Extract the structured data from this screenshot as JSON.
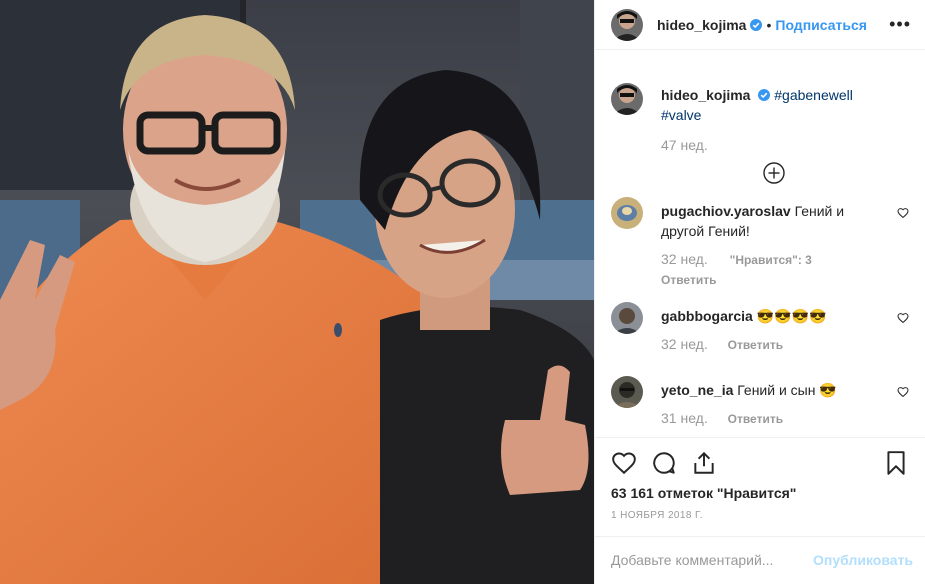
{
  "post": {
    "author": "hideo_kojima",
    "follow_label": "Подписаться",
    "dot": "•",
    "more_label": "•••"
  },
  "caption": {
    "author": "hideo_kojima",
    "hashtags": "#gabenewell #valve",
    "age": "47 нед."
  },
  "comments": [
    {
      "user": "pugachiov.yaroslav",
      "text": "Гений и другой Гений!",
      "age": "32 нед.",
      "likes": "\"Нравится\": 3",
      "reply": "Ответить"
    },
    {
      "user": "gabbbogarcia",
      "text": "😎😎😎😎",
      "age": "32 нед.",
      "reply": "Ответить"
    },
    {
      "user": "yeto_ne_ia",
      "text": "Гений и сын 😎",
      "age": "31 нед.",
      "reply": "Ответить"
    }
  ],
  "stats": {
    "likes": "63 161 отметок \"Нравится\"",
    "date": "1 НОЯБРЯ 2018 Г."
  },
  "comment_box": {
    "placeholder": "Добавьте комментарий...",
    "publish": "Опубликовать"
  },
  "colors": {
    "link": "#3897f0",
    "hashtag": "#003569",
    "muted": "#999999",
    "publish_disabled": "#b2dffc"
  }
}
